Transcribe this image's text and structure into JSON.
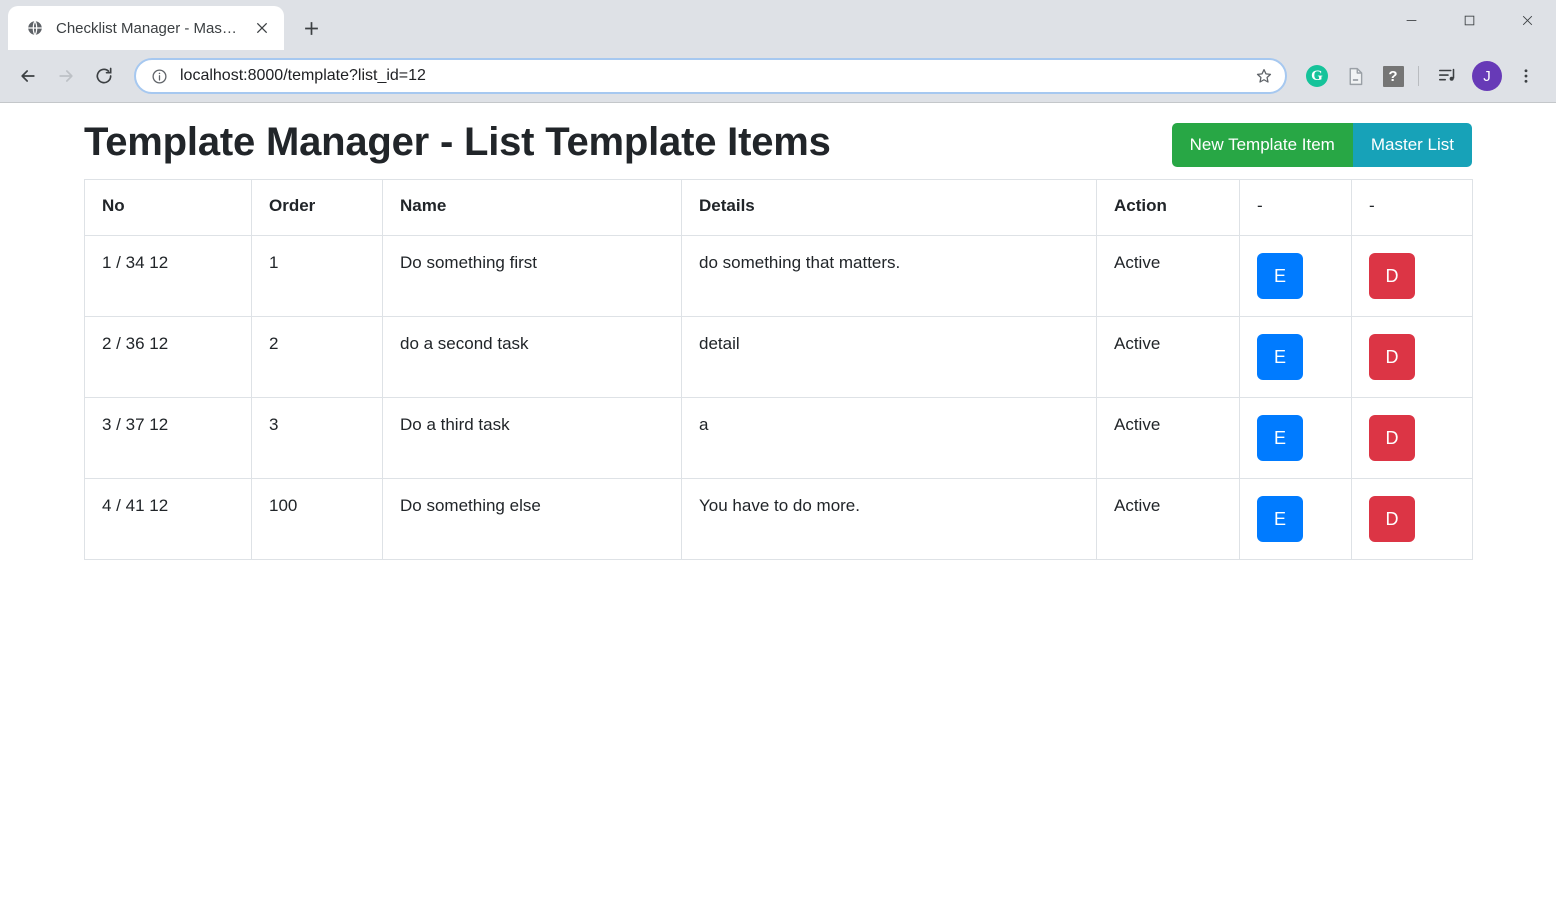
{
  "browser": {
    "tab": {
      "title": "Checklist Manager - MasterList",
      "favicon_icon": "globe-icon",
      "close_icon": "close-icon"
    },
    "new_tab_icon": "plus-icon",
    "window_controls": {
      "minimize_icon": "minimize-icon",
      "maximize_icon": "maximize-icon",
      "close_icon": "window-close-icon"
    },
    "toolbar": {
      "back_icon": "back-arrow-icon",
      "forward_icon": "forward-arrow-icon",
      "reload_icon": "reload-icon",
      "info_icon": "info-circle-icon",
      "url": "localhost:8000/template?list_id=12",
      "bookmark_icon": "star-icon",
      "extensions": [
        {
          "name": "grammarly-extension-icon",
          "label": "G"
        },
        {
          "name": "document-extension-icon",
          "label": ""
        },
        {
          "name": "question-extension-icon",
          "label": "?"
        },
        {
          "name": "media-playlist-icon",
          "label": ""
        }
      ],
      "avatar_label": "J",
      "menu_icon": "three-dot-menu-icon"
    }
  },
  "page": {
    "title": "Template Manager - List Template Items",
    "actions": {
      "new_template_item": "New Template Item",
      "master_list": "Master List"
    },
    "colors": {
      "new_button": "#28a745",
      "master_button": "#17a2b8",
      "edit_button": "#007bff",
      "delete_button": "#dc3545",
      "avatar": "#673ab7",
      "grammarly": "#15c39a",
      "table_border": "#dee2e6"
    },
    "table": {
      "headers": [
        "No",
        "Order",
        "Name",
        "Details",
        "Action",
        "-",
        "-"
      ],
      "rows": [
        {
          "no": "1 / 34 12",
          "order": "1",
          "name": "Do something first",
          "details": "do something that matters.",
          "action": "Active",
          "edit": "E",
          "delete": "D"
        },
        {
          "no": "2 / 36 12",
          "order": "2",
          "name": "do a second task",
          "details": "detail",
          "action": "Active",
          "edit": "E",
          "delete": "D"
        },
        {
          "no": "3 / 37 12",
          "order": "3",
          "name": "Do a third task",
          "details": "a",
          "action": "Active",
          "edit": "E",
          "delete": "D"
        },
        {
          "no": "4 / 41 12",
          "order": "100",
          "name": "Do something else",
          "details": "You have to do more.",
          "action": "Active",
          "edit": "E",
          "delete": "D"
        }
      ]
    }
  }
}
